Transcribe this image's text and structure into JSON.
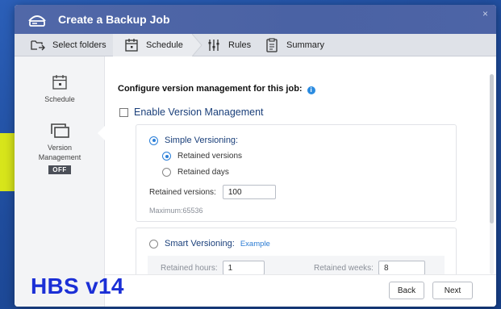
{
  "window": {
    "title": "Create a Backup Job",
    "close_glyph": "×"
  },
  "steps": [
    {
      "label": "Select folders",
      "icon": "folder-sync-icon"
    },
    {
      "label": "Schedule",
      "icon": "calendar-icon"
    },
    {
      "label": "Rules",
      "icon": "sliders-icon"
    },
    {
      "label": "Summary",
      "icon": "clipboard-icon"
    }
  ],
  "sidebar": {
    "schedule_label": "Schedule",
    "version_label_line1": "Version",
    "version_label_line2": "Management",
    "version_status": "OFF"
  },
  "main": {
    "heading": "Configure version management for this job:",
    "info_glyph": "i",
    "enable_label": "Enable Version Management",
    "simple": {
      "label": "Simple Versioning:",
      "retained_versions_option": "Retained versions",
      "retained_days_option": "Retained days",
      "field_label": "Retained versions:",
      "field_value": "100",
      "maximum": "Maximum:65536"
    },
    "smart": {
      "label": "Smart Versioning:",
      "example_link": "Example",
      "hours_label": "Retained hours:",
      "hours_value": "1",
      "weeks_label": "Retained weeks:",
      "weeks_value": "8"
    }
  },
  "footer": {
    "back": "Back",
    "next": "Next"
  },
  "overlay": {
    "text": "HBS v14"
  },
  "colors": {
    "accent": "#2b7fd8",
    "titlebar": "#4d64a6",
    "overlay_text": "#1b2fd6",
    "arrow": "#d7e51b"
  }
}
